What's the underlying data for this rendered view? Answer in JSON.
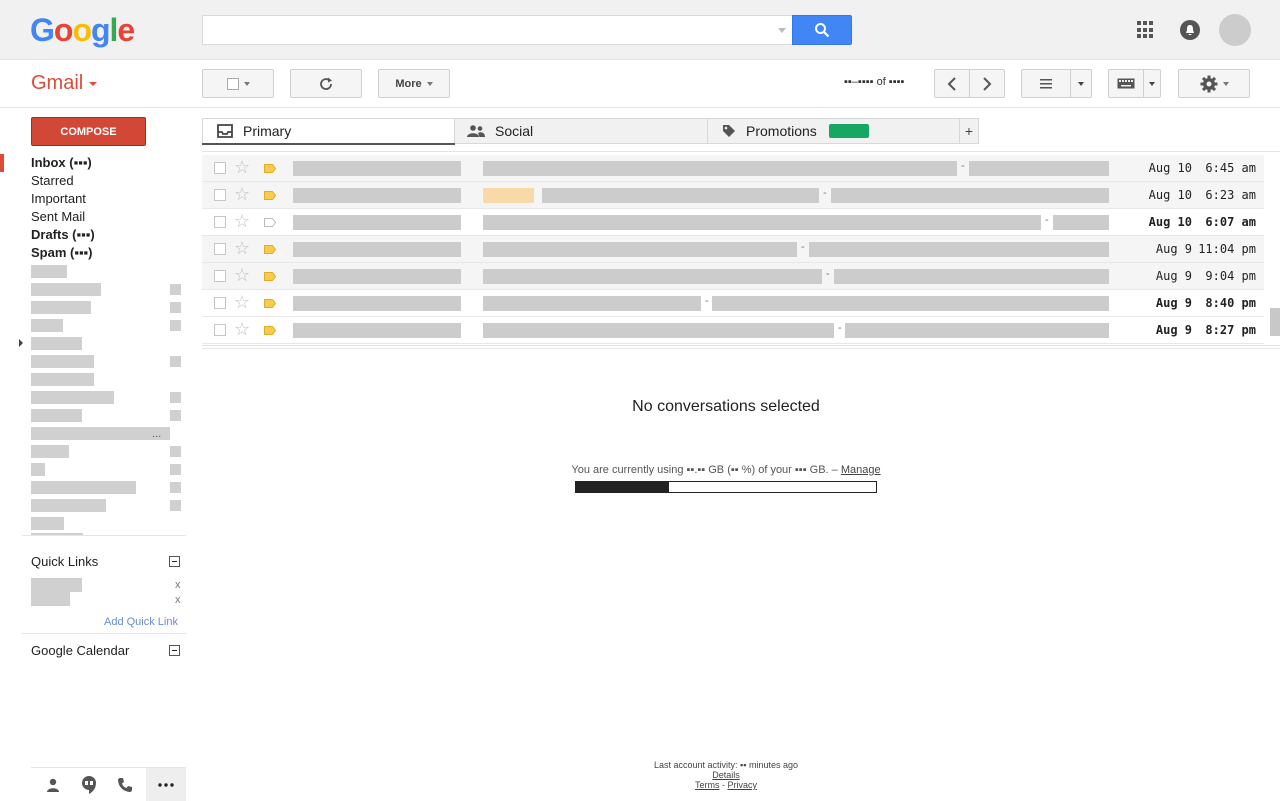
{
  "header": {
    "logo_letters": [
      {
        "ch": "G",
        "color": "#4285f4"
      },
      {
        "ch": "o",
        "color": "#ea4335"
      },
      {
        "ch": "o",
        "color": "#fbbc05"
      },
      {
        "ch": "g",
        "color": "#4285f4"
      },
      {
        "ch": "l",
        "color": "#34a853"
      },
      {
        "ch": "e",
        "color": "#ea4335"
      }
    ],
    "search_value": "",
    "search_icon": "search-icon",
    "apps_icon": "apps-grid-icon",
    "notifications_icon": "bell-icon"
  },
  "toolbar": {
    "app_name": "Gmail",
    "more_label": "More",
    "pager": "▪▪–▪▪▪▪ of ▪▪▪▪"
  },
  "nav": {
    "compose_label": "COMPOSE",
    "items": [
      {
        "label": "Inbox (▪▪▪)",
        "bold": true
      },
      {
        "label": "Starred",
        "bold": false
      },
      {
        "label": "Important",
        "bold": false
      },
      {
        "label": "Sent Mail",
        "bold": false
      },
      {
        "label": "Drafts (▪▪▪)",
        "bold": true
      },
      {
        "label": "Spam (▪▪▪)",
        "bold": true
      }
    ],
    "labels_more": "...",
    "quick_links_title": "Quick Links",
    "quick_link_remove": "x",
    "add_quick_link": "Add Quick Link",
    "calendar_title": "Google Calendar"
  },
  "tabs": [
    {
      "label": "Primary",
      "icon": "inbox-icon",
      "active": true
    },
    {
      "label": "Social",
      "icon": "people-icon",
      "active": false
    },
    {
      "label": "Promotions",
      "icon": "tag-icon",
      "active": false
    }
  ],
  "messages": [
    {
      "date": "Aug 10",
      "time": "6:45 am",
      "unread": false,
      "important": true
    },
    {
      "date": "Aug 10",
      "time": "6:23 am",
      "unread": false,
      "important": true
    },
    {
      "date": "Aug 10",
      "time": "6:07 am",
      "unread": true,
      "important": false
    },
    {
      "date": "Aug 9",
      "time": "11:04 pm",
      "unread": false,
      "important": true
    },
    {
      "date": "Aug 9",
      "time": "9:04 pm",
      "unread": false,
      "important": true
    },
    {
      "date": "Aug 9",
      "time": "8:40 pm",
      "unread": true,
      "important": true
    },
    {
      "date": "Aug 9",
      "time": "8:27 pm",
      "unread": true,
      "important": true
    }
  ],
  "reading_pane": {
    "no_conversations": "No conversations selected",
    "storage_text": "You are currently using ▪▪.▪▪ GB (▪▪ %) of your ▪▪▪ GB. –",
    "manage_link": "Manage",
    "storage_fraction": 0.31
  },
  "footer": {
    "activity": "Last account activity: ▪▪ minutes ago",
    "details": "Details",
    "terms": "Terms",
    "sep": "-",
    "privacy": "Privacy"
  },
  "colors": {
    "accent_red": "#dd4b39",
    "compose_red": "#d14836",
    "search_blue": "#4285f4",
    "important_yellow": "#f9cb4c",
    "promotions_green": "#16a765"
  }
}
